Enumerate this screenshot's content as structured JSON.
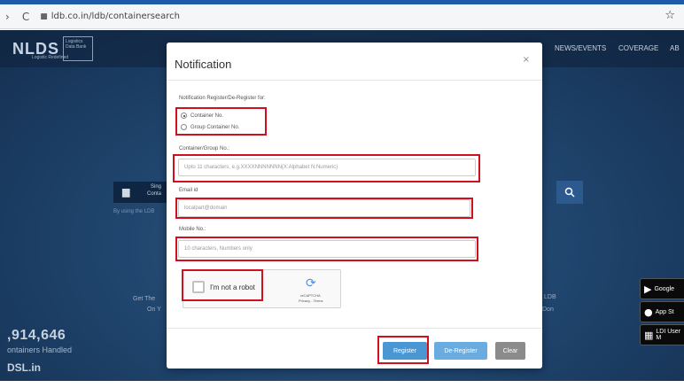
{
  "browser": {
    "url": "ldb.co.in/ldb/containersearch",
    "back_glyph": "›",
    "reload_glyph": "C",
    "lock_glyph": "🔒",
    "star_glyph": "☆"
  },
  "site": {
    "logo_text": "NLDS",
    "logo_sub": "Logistics Data Bank",
    "logo_tag": "Logistic Redefined",
    "nav": [
      "NEWS/EVENTS",
      "COVERAGE",
      "AB"
    ],
    "search_icon": "🔍",
    "container_glyph": "▆",
    "side_text_left": "Sing",
    "side_text_left2": "Conta",
    "by_using": "By using the LDB",
    "get_the": "Get The",
    "on_y": "On Y",
    "ldb_right": "LDB",
    "don_right": "Don",
    "stat_number": ",914,646",
    "stat_caption": "ontainers Handled",
    "site_name": "DSL.in",
    "badges": [
      {
        "icon": "▶",
        "label": "Google"
      },
      {
        "icon": "",
        "label": "App St"
      },
      {
        "icon": "▦",
        "label": "LDI User M"
      }
    ]
  },
  "modal": {
    "title": "Notification",
    "close": "×",
    "register_for_label": "Notification Register/De-Register for:",
    "options": [
      "Container No.",
      "Group Container No."
    ],
    "selected_option": "Container No.",
    "container_label": "Container/Group No.:",
    "container_placeholder": "Upto 11 characters, e.g.XXXXNNNNNNN(X:Alphabet N:Numeric)",
    "email_label": "Email id",
    "email_placeholder": "localpart@domain",
    "mobile_label": "Mobile No.:",
    "mobile_placeholder": "10 characters, Numbers only",
    "captcha_label": "I'm not a robot",
    "captcha_brand": "reCAPTCHA",
    "captcha_terms": "Privacy - Terms",
    "buttons": {
      "register": "Register",
      "deregister": "De-Register",
      "clear": "Clear"
    }
  },
  "colors": {
    "highlight": "#d0101e",
    "primary_button": "#4b97d3",
    "secondary_button": "#6aacdf",
    "clear_button": "#8b8b8b"
  }
}
